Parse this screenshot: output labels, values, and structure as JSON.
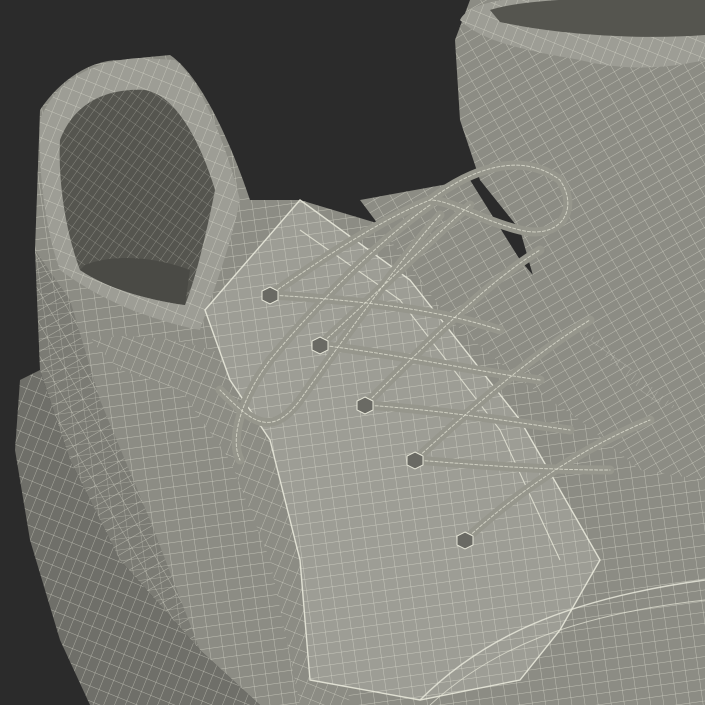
{
  "scene": {
    "subject": "shoe-wireframe",
    "colors": {
      "background": "#2b2b2b",
      "surface": "#8c8c84",
      "surface_light": "#9d9d95",
      "surface_dark": "#6f6f69",
      "interior": "#55554f",
      "wire": "#e8e8da",
      "lace": "#96968c",
      "eyelet": "#6a6a64"
    }
  }
}
